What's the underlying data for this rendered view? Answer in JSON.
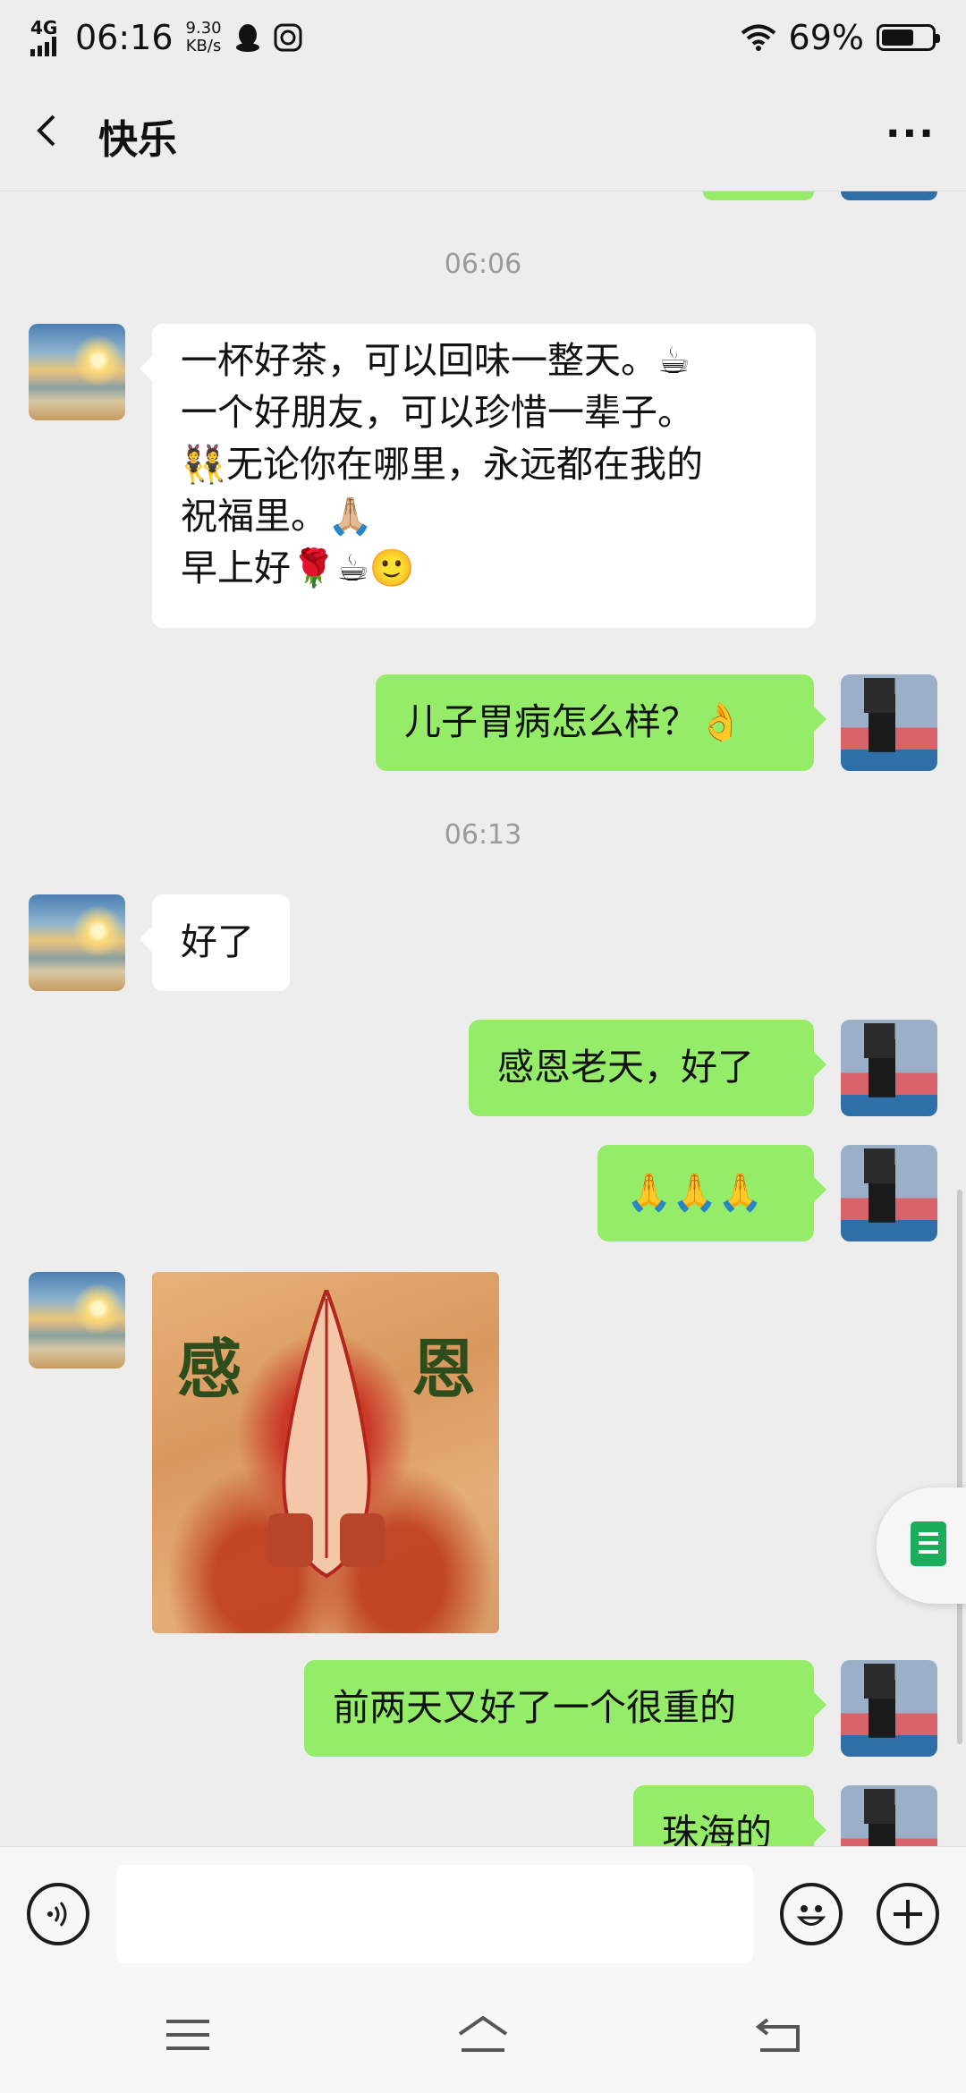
{
  "status_bar": {
    "network": "4G",
    "time": "06:16",
    "speed": "9.30",
    "speed_unit": "KB/s",
    "battery": "69%",
    "battery_level": 0.69
  },
  "header": {
    "title": "快乐",
    "more": "···"
  },
  "messages": [
    {
      "kind": "timestamp",
      "text": "06:06"
    },
    {
      "kind": "text",
      "side": "in",
      "lines": [
        "一杯好茶，可以回味一整天。☕",
        "一个好朋友，可以珍惜一辈子。",
        "👯无论你在哪里，永远都在我的",
        "祝福里。🙏🏼",
        "早上好🌹☕🙂"
      ]
    },
    {
      "kind": "text",
      "side": "out",
      "lines": [
        "儿子胃病怎么样？👌"
      ]
    },
    {
      "kind": "timestamp",
      "text": "06:13"
    },
    {
      "kind": "text",
      "side": "in",
      "lines": [
        "好了"
      ]
    },
    {
      "kind": "text",
      "side": "out",
      "lines": [
        "感恩老天，好了"
      ]
    },
    {
      "kind": "text",
      "side": "out",
      "lines": [
        "🙏🙏🙏"
      ]
    },
    {
      "kind": "image",
      "side": "in",
      "chars": [
        "感",
        "恩"
      ]
    },
    {
      "kind": "text",
      "side": "out",
      "lines": [
        "前两天又好了一个很重的"
      ]
    },
    {
      "kind": "text",
      "side": "out",
      "lines": [
        "珠海的"
      ]
    }
  ],
  "input_bar": {
    "voice_icon": "voice-icon",
    "emoji_icon": "emoji-icon",
    "plus_icon": "plus-icon",
    "placeholder": ""
  },
  "colors": {
    "background": "#ededed",
    "bubble_out": "#95ec69",
    "bubble_in": "#ffffff",
    "timestamp": "#9a9a9a"
  }
}
